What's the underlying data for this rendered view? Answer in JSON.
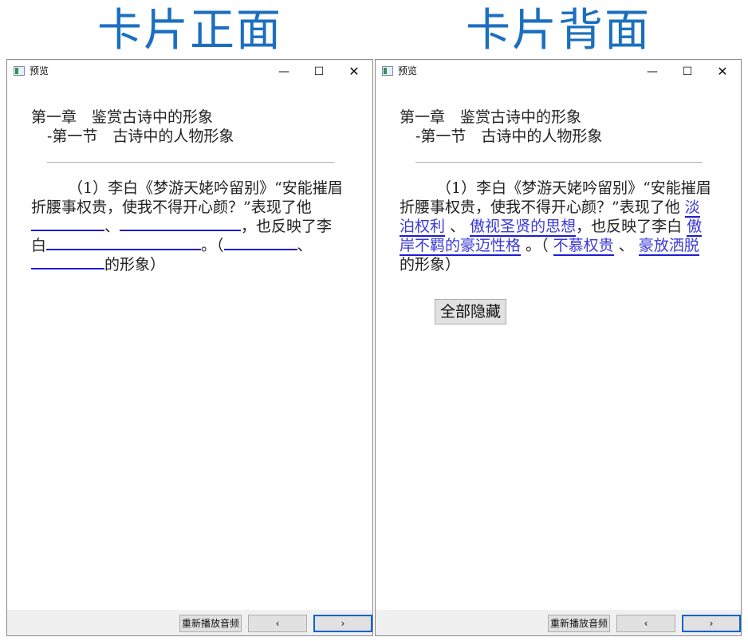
{
  "headings": {
    "front": "卡片正面",
    "back": "卡片背面"
  },
  "window": {
    "title": "预览",
    "minimize": "—",
    "maximize": "☐",
    "close": "✕"
  },
  "card": {
    "chapter": "第一章　鉴赏古诗中的形象",
    "section": "-第一节　古诗中的人物形象",
    "question": {
      "p1": "（1）李白《梦游天姥吟留别》“安能摧眉折腰事权贵，使我不得开心颜？”表现了他",
      "sep1": "、",
      "p2": "，也反映了李白",
      "p3": "。（",
      "sep2": "、",
      "p4": "的形象）"
    },
    "answers": [
      "淡泊权利",
      "傲视圣贤的思想",
      "傲岸不羁的豪迈性格",
      "不慕权贵",
      "豪放洒脱"
    ]
  },
  "buttons": {
    "hide_all": "全部隐藏",
    "replay_audio": "重新播放音频",
    "prev": "‹",
    "next": "›"
  }
}
